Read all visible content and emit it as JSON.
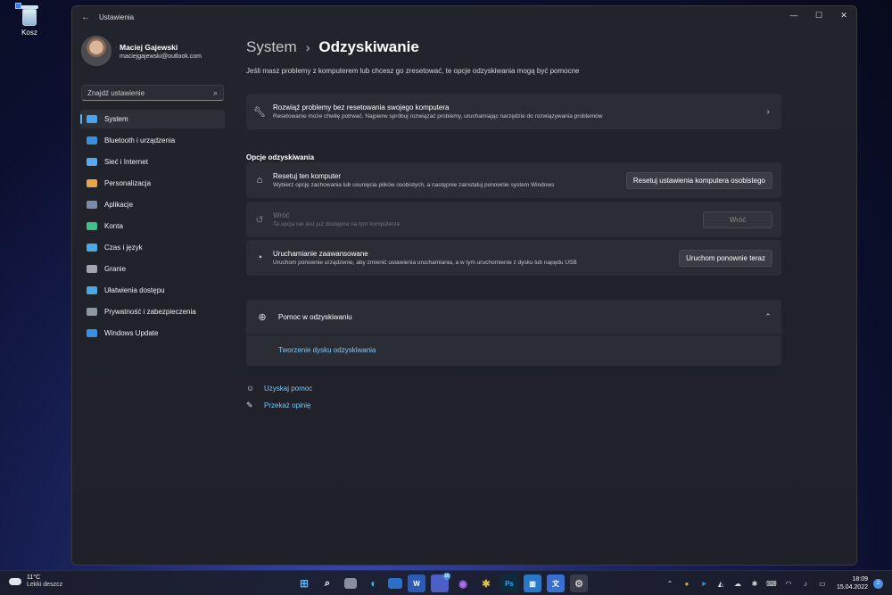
{
  "desktop": {
    "recycle_bin_label": "Kosz"
  },
  "window": {
    "title": "Ustawienia",
    "minimize": "—",
    "maximize": "☐",
    "close": "✕"
  },
  "profile": {
    "name": "Maciej Gajewski",
    "email": "maciejgajewski@outlook.com"
  },
  "search": {
    "placeholder": "Znajdź ustawienie"
  },
  "nav": [
    {
      "label": "System",
      "icon": "display-icon",
      "color": "#4aa3f0"
    },
    {
      "label": "Bluetooth i urządzenia",
      "icon": "bluetooth-icon",
      "color": "#3b8ee0"
    },
    {
      "label": "Sieć i Internet",
      "icon": "wifi-icon",
      "color": "#5aa8ee"
    },
    {
      "label": "Personalizacja",
      "icon": "brush-icon",
      "color": "#e8a44a"
    },
    {
      "label": "Aplikacje",
      "icon": "apps-icon",
      "color": "#7a8aa8"
    },
    {
      "label": "Konta",
      "icon": "person-icon",
      "color": "#3fbf8a"
    },
    {
      "label": "Czas i język",
      "icon": "globe-clock-icon",
      "color": "#49a9e0"
    },
    {
      "label": "Granie",
      "icon": "gamepad-icon",
      "color": "#a0a4ae"
    },
    {
      "label": "Ułatwienia dostępu",
      "icon": "accessibility-icon",
      "color": "#49a9e0"
    },
    {
      "label": "Prywatność i zabezpieczenia",
      "icon": "shield-icon",
      "color": "#8f96a4"
    },
    {
      "label": "Windows Update",
      "icon": "update-icon",
      "color": "#3b8ee0"
    }
  ],
  "breadcrumb": {
    "parent": "System",
    "separator": "›",
    "current": "Odzyskiwanie"
  },
  "description": "Jeśli masz problemy z komputerem lub chcesz go zresetować, te opcje odzyskiwania mogą być pomocne",
  "troubleshoot": {
    "title": "Rozwiąż problemy bez resetowania swojego komputera",
    "subtitle": "Resetowanie może chwilę potrwać. Najpierw spróbuj rozwiązać problemy, uruchamiając narzędzie do rozwiązywania problemów"
  },
  "section_label": "Opcje odzyskiwania",
  "options": {
    "reset": {
      "title": "Resetuj ten komputer",
      "subtitle": "Wybierz opcję zachowania lub usunięcia plików osobistych, a następnie zainstaluj ponownie system Windows",
      "button": "Resetuj ustawienia komputera osobistego"
    },
    "goback": {
      "title": "Wróć",
      "subtitle": "Ta opcja nie jest już dostępna na tym komputerze",
      "button": "Wróć"
    },
    "advanced": {
      "title": "Uruchamianie zaawansowane",
      "subtitle": "Uruchom ponownie urządzenie, aby zmienić ustawienia uruchamiania, a w tym uruchomienie z dysku lub napędu USB",
      "button": "Uruchom ponownie teraz"
    }
  },
  "help": {
    "title": "Pomoc w odzyskiwaniu",
    "link": "Tworzenie dysku odzyskiwania"
  },
  "links": {
    "get_help": "Uzyskaj pomoc",
    "feedback": "Przekaż opinię"
  },
  "taskbar": {
    "weather_temp": "11°C",
    "weather_desc": "Lekki deszcz",
    "teams_badge": "10",
    "time": "18:09",
    "date": "15.04.2022",
    "notifications": "2"
  }
}
